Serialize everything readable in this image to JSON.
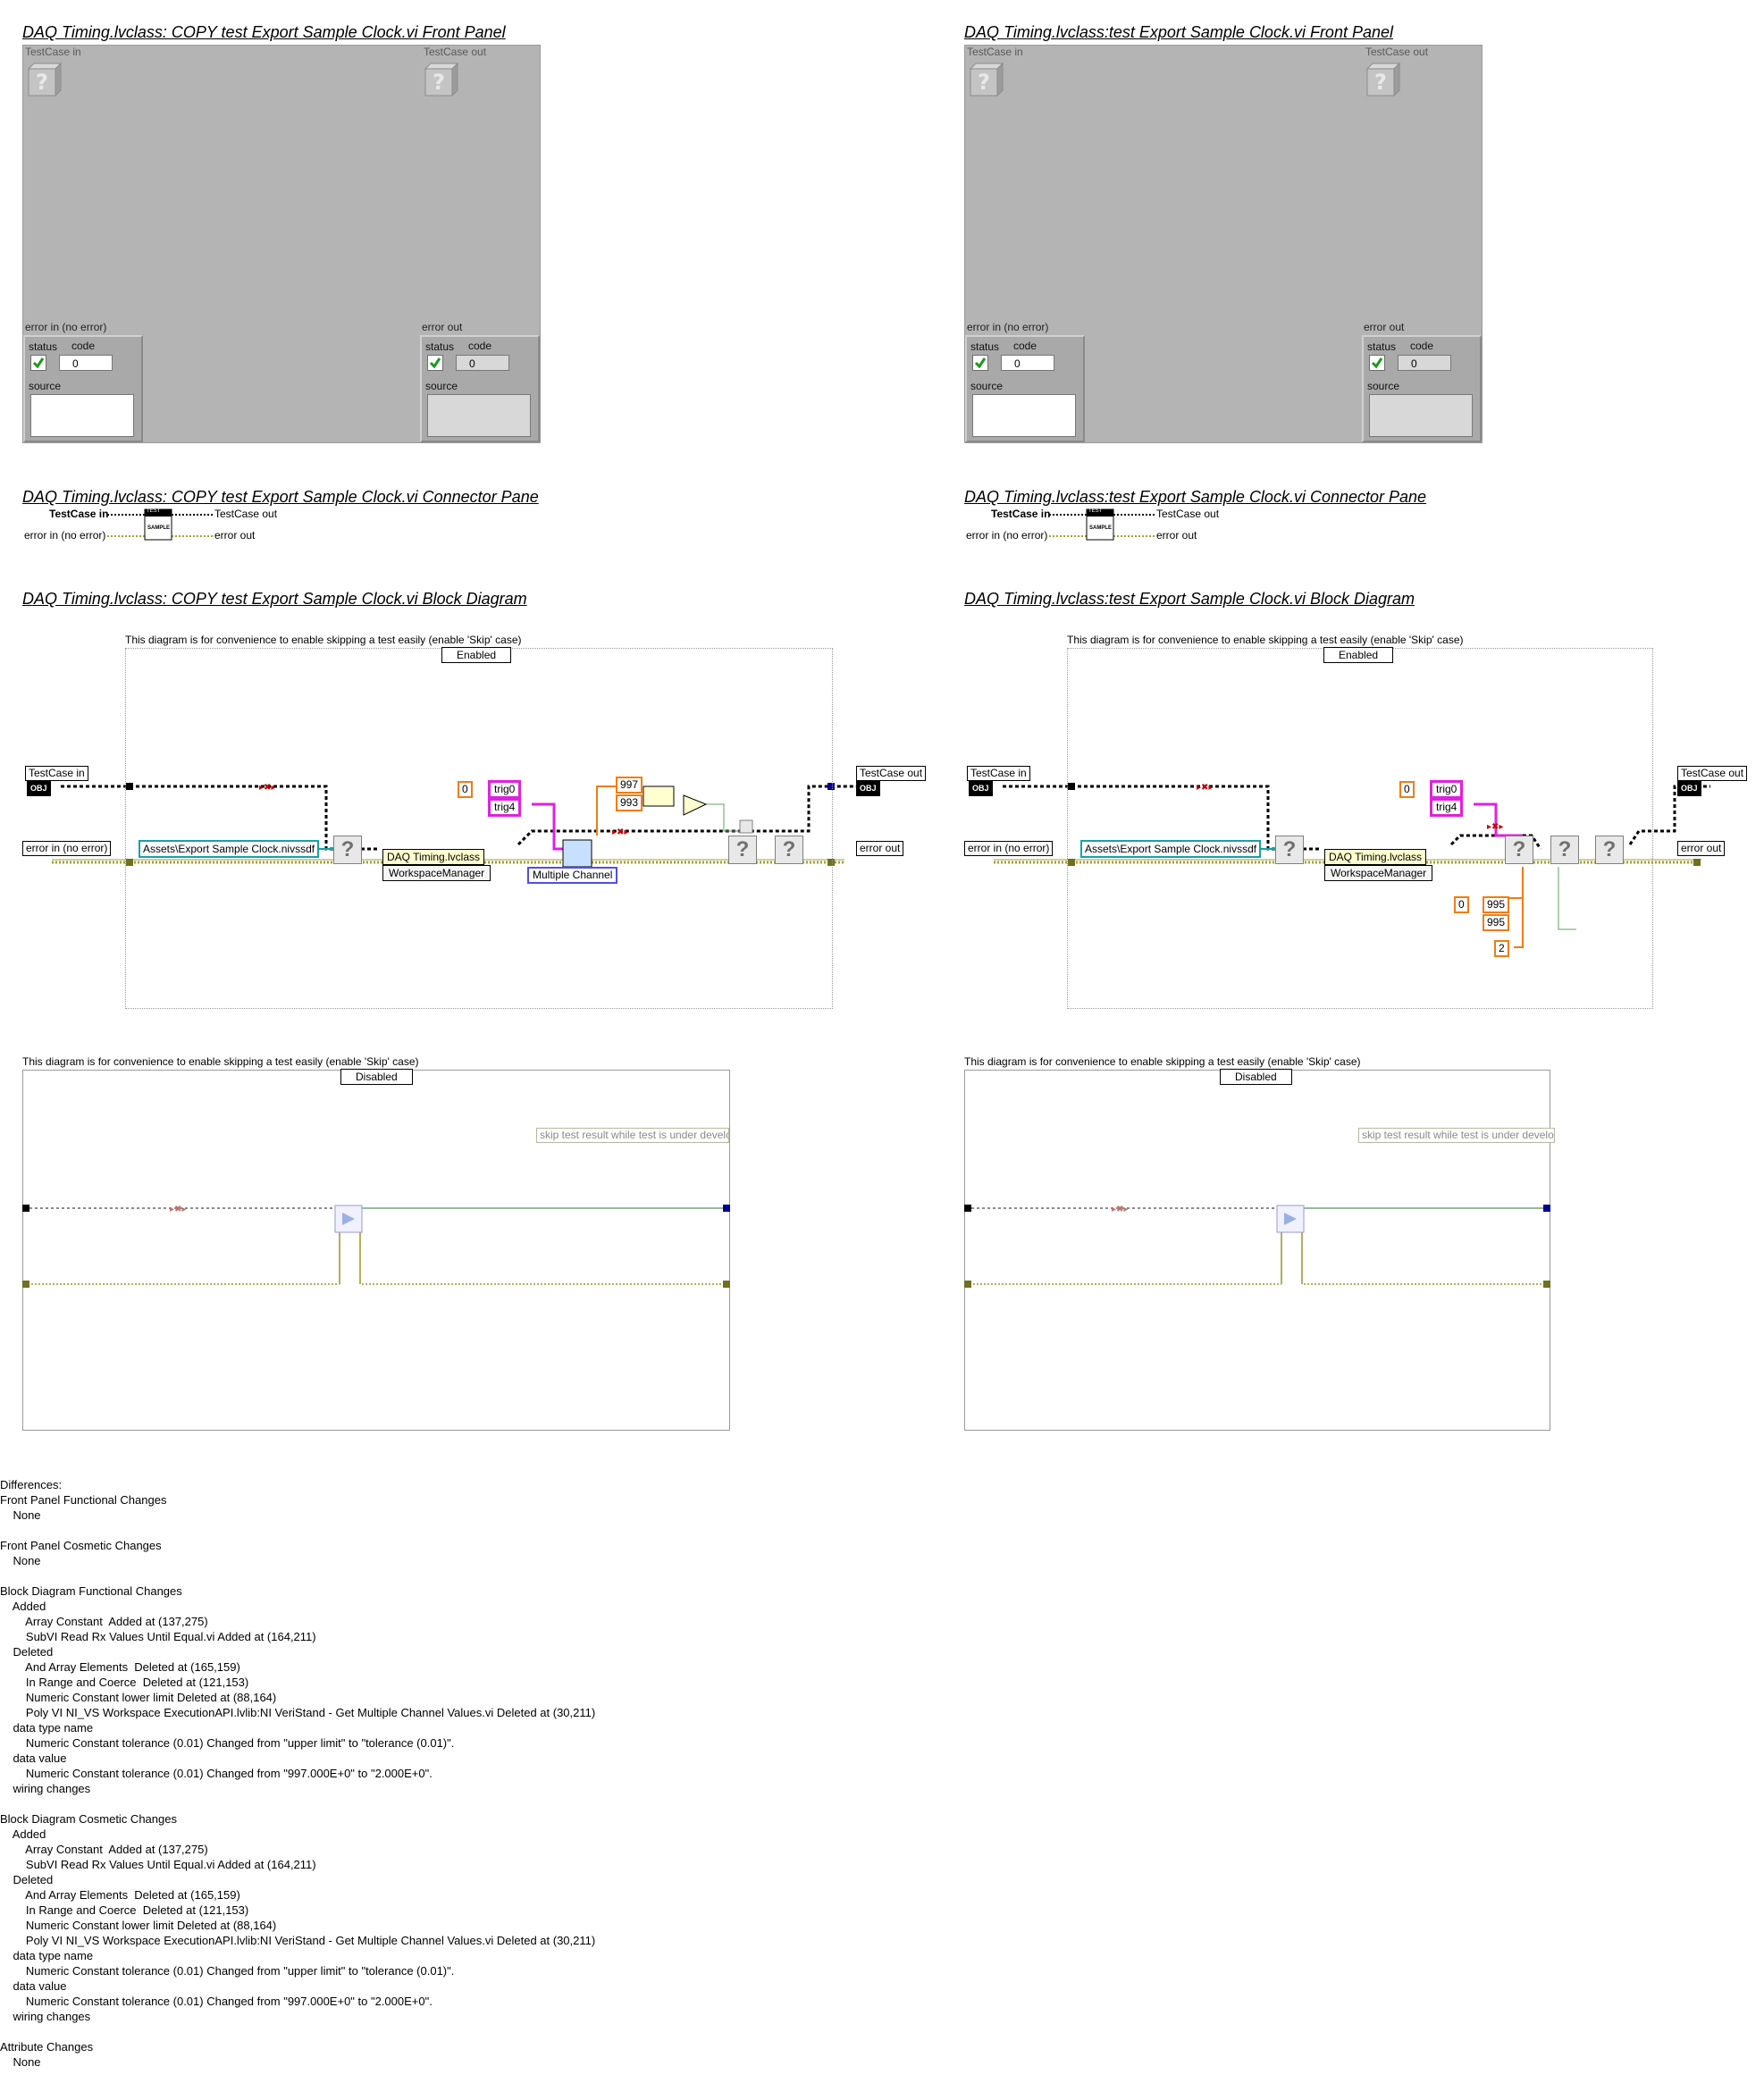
{
  "left": {
    "fp_title": "DAQ Timing.lvclass:  COPY  test Export Sample Clock.vi Front Panel",
    "cp_title": "DAQ Timing.lvclass:  COPY  test Export Sample Clock.vi Connector Pane",
    "bd_title": "DAQ Timing.lvclass:  COPY  test Export Sample Clock.vi Block Diagram",
    "case_enabled": "Enabled",
    "case_disabled": "Disabled",
    "strings": [
      "trig0",
      "trig4"
    ],
    "array_index": "0",
    "numbers": [
      "997",
      "993"
    ],
    "enum": "Multiple Channel"
  },
  "right": {
    "fp_title": "DAQ Timing.lvclass:test Export Sample Clock.vi Front Panel",
    "cp_title": "DAQ Timing.lvclass:test Export Sample Clock.vi Connector Pane",
    "bd_title": "DAQ Timing.lvclass:test Export Sample Clock.vi Block Diagram",
    "case_enabled": "Enabled",
    "case_disabled": "Disabled",
    "strings": [
      "trig0",
      "trig4"
    ],
    "array_index": "0",
    "array_index2": "0",
    "numbers": [
      "995",
      "995"
    ],
    "tolerance": "2"
  },
  "common": {
    "testcase_in": "TestCase in",
    "testcase_out": "TestCase out",
    "error_in": "error in (no error)",
    "error_out": "error out",
    "status": "status",
    "code": "code",
    "source": "source",
    "code_value": "0",
    "obj": "OBJ",
    "sample": "SAMPLE",
    "test": "TEST",
    "comment": "This diagram is for convenience to enable skipping a test easily (enable 'Skip' case)",
    "asset_path": "Assets\\Export Sample Clock.nivssdf",
    "class_name": "DAQ Timing.lvclass",
    "workspace": "WorkspaceManager",
    "skip_text": "skip test result while test is under develo",
    "status_icon": "checkmark-icon",
    "question_icon": "question-mark-icon"
  },
  "differences": "Differences:\nFront Panel Functional Changes\n    None\n\nFront Panel Cosmetic Changes\n    None\n\nBlock Diagram Functional Changes\n    Added\n        Array Constant  Added at (137,275)\n        SubVI Read Rx Values Until Equal.vi Added at (164,211)\n    Deleted\n        And Array Elements  Deleted at (165,159)\n        In Range and Coerce  Deleted at (121,153)\n        Numeric Constant lower limit Deleted at (88,164)\n        Poly VI NI_VS Workspace ExecutionAPI.lvlib:NI VeriStand - Get Multiple Channel Values.vi Deleted at (30,211)\n    data type name\n        Numeric Constant tolerance (0.01) Changed from \"upper limit\" to \"tolerance (0.01)\".\n    data value\n        Numeric Constant tolerance (0.01) Changed from \"997.000E+0\" to \"2.000E+0\".\n    wiring changes\n\nBlock Diagram Cosmetic Changes\n    Added\n        Array Constant  Added at (137,275)\n        SubVI Read Rx Values Until Equal.vi Added at (164,211)\n    Deleted\n        And Array Elements  Deleted at (165,159)\n        In Range and Coerce  Deleted at (121,153)\n        Numeric Constant lower limit Deleted at (88,164)\n        Poly VI NI_VS Workspace ExecutionAPI.lvlib:NI VeriStand - Get Multiple Channel Values.vi Deleted at (30,211)\n    data type name\n        Numeric Constant tolerance (0.01) Changed from \"upper limit\" to \"tolerance (0.01)\".\n    data value\n        Numeric Constant tolerance (0.01) Changed from \"997.000E+0\" to \"2.000E+0\".\n    wiring changes\n\nAttribute Changes\n    None"
}
